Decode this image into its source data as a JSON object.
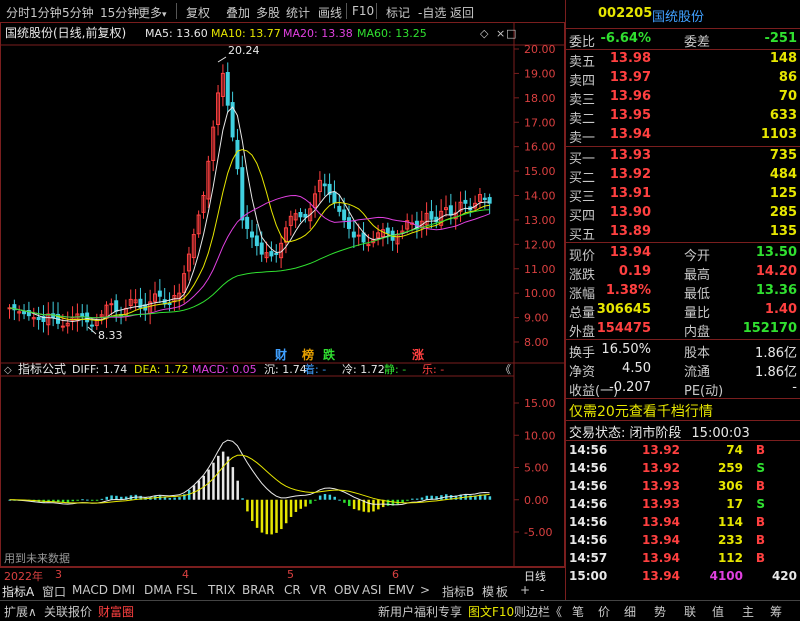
{
  "toolbar": {
    "items": [
      "分时",
      "1分钟",
      "5分钟",
      "15分钟",
      "更多",
      "复权",
      "叠加",
      "多股",
      "统计",
      "画线",
      "F10",
      "标记",
      "-自选",
      "返回"
    ]
  },
  "chart": {
    "title": "国统股份(日线,前复权)",
    "ma": [
      {
        "label": "MA5: 13.60",
        "color": "#e8e8e8"
      },
      {
        "label": "MA10: 13.77",
        "color": "#e6e600"
      },
      {
        "label": "MA20: 13.38",
        "color": "#e040e0"
      },
      {
        "label": "MA60: 13.25",
        "color": "#30e030"
      }
    ],
    "price_axis": [
      "20.00",
      "19.00",
      "18.00",
      "17.00",
      "16.00",
      "15.00",
      "14.00",
      "13.00",
      "12.00",
      "11.00",
      "10.00",
      "9.00",
      "8.00"
    ],
    "high_label": "20.24",
    "low_label": "8.33",
    "markers": [
      {
        "text": "财",
        "color": "#40a0ff"
      },
      {
        "text": "榜",
        "color": "#e6a000"
      },
      {
        "text": "跌",
        "color": "#30e030"
      },
      {
        "text": "涨",
        "color": "#ff4040"
      }
    ],
    "indicator": {
      "title": "指标公式",
      "values": [
        {
          "label": "DIFF: 1.74",
          "color": "#e8e8e8"
        },
        {
          "label": "DEA: 1.72",
          "color": "#e6e600"
        },
        {
          "label": "MACD: 0.05",
          "color": "#e040e0"
        },
        {
          "label": "沉: 1.74",
          "color": "#e8e8e8"
        },
        {
          "label": "着: -",
          "color": "#40a0ff"
        },
        {
          "label": "冷: 1.72",
          "color": "#e8e8e8"
        },
        {
          "label": "静: -",
          "color": "#30e030"
        },
        {
          "label": "乐: -",
          "color": "#ff4040"
        }
      ],
      "axis": [
        "15.00",
        "10.00",
        "5.00",
        "0.00",
        "-5.00"
      ],
      "note": "用到未来数据"
    },
    "time_axis": [
      "2022年",
      "3",
      "4",
      "5",
      "6"
    ],
    "period": "日线"
  },
  "tabs": [
    "指标A",
    "窗口",
    "MACD",
    "DMI",
    "DMA",
    "FSL",
    "TRIX",
    "BRAR",
    "CR",
    "VR",
    "OBV",
    "ASI",
    "EMV",
    ">",
    "指标B",
    "模",
    "板",
    "+",
    "-"
  ],
  "statusbar": {
    "left": [
      "扩展∧",
      "关联报价",
      "财富圈"
    ],
    "right": [
      "新用户福利专享",
      "图文F10",
      "则边栏《",
      "笔",
      "价",
      "细",
      "势",
      "联",
      "值",
      "主",
      "筹"
    ]
  },
  "quote": {
    "code": "002205",
    "name": "国统股份",
    "wei_bi_label": "委比",
    "wei_bi": "-6.64%",
    "wei_cha_label": "委差",
    "wei_cha": "-251",
    "asks": [
      {
        "label": "卖五",
        "price": "13.98",
        "vol": "148"
      },
      {
        "label": "卖四",
        "price": "13.97",
        "vol": "86"
      },
      {
        "label": "卖三",
        "price": "13.96",
        "vol": "70"
      },
      {
        "label": "卖二",
        "price": "13.95",
        "vol": "633"
      },
      {
        "label": "卖一",
        "price": "13.94",
        "vol": "1103"
      }
    ],
    "bids": [
      {
        "label": "买一",
        "price": "13.93",
        "vol": "735"
      },
      {
        "label": "买二",
        "price": "13.92",
        "vol": "484"
      },
      {
        "label": "买三",
        "price": "13.91",
        "vol": "125"
      },
      {
        "label": "买四",
        "price": "13.90",
        "vol": "285"
      },
      {
        "label": "买五",
        "price": "13.89",
        "vol": "135"
      }
    ],
    "stats": [
      {
        "l": "现价",
        "v": "13.94",
        "vc": "red",
        "l2": "今开",
        "v2": "13.50",
        "v2c": "green"
      },
      {
        "l": "涨跌",
        "v": "0.19",
        "vc": "red",
        "l2": "最高",
        "v2": "14.20",
        "v2c": "red"
      },
      {
        "l": "涨幅",
        "v": "1.38%",
        "vc": "red",
        "l2": "最低",
        "v2": "13.36",
        "v2c": "green"
      },
      {
        "l": "总量",
        "v": "306645",
        "vc": "yellow",
        "l2": "量比",
        "v2": "1.40",
        "v2c": "red"
      },
      {
        "l": "外盘",
        "v": "154475",
        "vc": "red",
        "l2": "内盘",
        "v2": "152170",
        "v2c": "green"
      }
    ],
    "stats2": [
      {
        "l": "换手",
        "v": "16.50%",
        "vc": "white",
        "l2": "股本",
        "v2": "1.86亿",
        "v2c": "white"
      },
      {
        "l": "净资",
        "v": "4.50",
        "vc": "white",
        "l2": "流通",
        "v2": "1.86亿",
        "v2c": "white"
      },
      {
        "l": "收益(一)",
        "v": "-0.207",
        "vc": "white",
        "l2": "PE(动)",
        "v2": "-",
        "v2c": "white"
      }
    ],
    "promo": "仅需20元查看千档行情",
    "trade_status_label": "交易状态:",
    "trade_status": "闭市阶段",
    "trade_time": "15:00:03",
    "ticks": [
      {
        "t": "14:56",
        "p": "13.92",
        "v": "74",
        "d": "B"
      },
      {
        "t": "14:56",
        "p": "13.92",
        "v": "259",
        "d": "S"
      },
      {
        "t": "14:56",
        "p": "13.93",
        "v": "306",
        "d": "B"
      },
      {
        "t": "14:56",
        "p": "13.93",
        "v": "17",
        "d": "S"
      },
      {
        "t": "14:56",
        "p": "13.94",
        "v": "114",
        "d": "B"
      },
      {
        "t": "14:56",
        "p": "13.94",
        "v": "233",
        "d": "B"
      },
      {
        "t": "14:57",
        "p": "13.94",
        "v": "112",
        "d": "B"
      },
      {
        "t": "15:00",
        "p": "13.94",
        "v": "4100",
        "d": "420"
      }
    ]
  },
  "colors": {
    "up": "#ff4040",
    "down": "#30e030",
    "grid": "#7a1e1e",
    "bg": "#000000"
  }
}
